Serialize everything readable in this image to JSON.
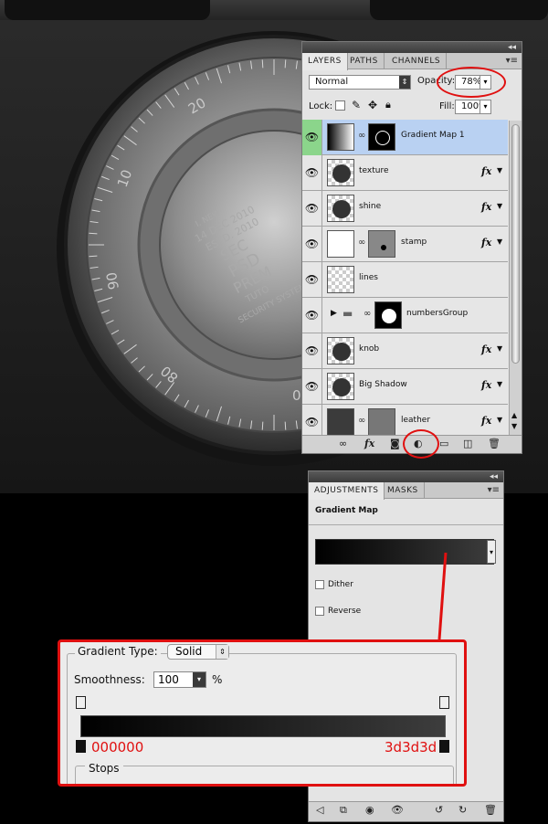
{
  "layers_panel": {
    "tabs": [
      "LAYERS",
      "PATHS",
      "CHANNELS"
    ],
    "blend_mode": "Normal",
    "opacity_label": "Opacity:",
    "opacity_value": "78%",
    "lock_label": "Lock:",
    "fill_label": "Fill:",
    "fill_value": "100%",
    "layers": [
      {
        "name": "Gradient Map 1",
        "selected": true
      },
      {
        "name": "texture"
      },
      {
        "name": "shine"
      },
      {
        "name": "stamp"
      },
      {
        "name": "lines"
      },
      {
        "name": "numbersGroup"
      },
      {
        "name": "knob"
      },
      {
        "name": "Big Shadow"
      },
      {
        "name": "leather"
      }
    ],
    "fx_label": "fx"
  },
  "adjustments_panel": {
    "tabs": [
      "ADJUSTMENTS",
      "MASKS"
    ],
    "title": "Gradient Map",
    "dither_label": "Dither",
    "reverse_label": "Reverse"
  },
  "gradient_editor": {
    "gradient_type_label": "Gradient Type:",
    "gradient_type_value": "Solid",
    "smoothness_label": "Smoothness:",
    "smoothness_value": "100",
    "smoothness_unit": "%",
    "stop_left_color": "000000",
    "stop_right_color": "3d3d3d",
    "stops_label": "Stops"
  },
  "dial": {
    "numbers": [
      "20",
      "10",
      "90",
      "80",
      "0"
    ],
    "stamp_lines": [
      "14 DEC 2010",
      "ESTD. 2010",
      "SEC",
      "PSD",
      "PREM",
      "TUTO",
      "SECURITY SYSTEM TE",
      "I. NEW"
    ]
  },
  "colors": {
    "accent_red": "#e01010",
    "selection_blue": "#b9d1f2",
    "visible_green": "#8bd58b"
  }
}
